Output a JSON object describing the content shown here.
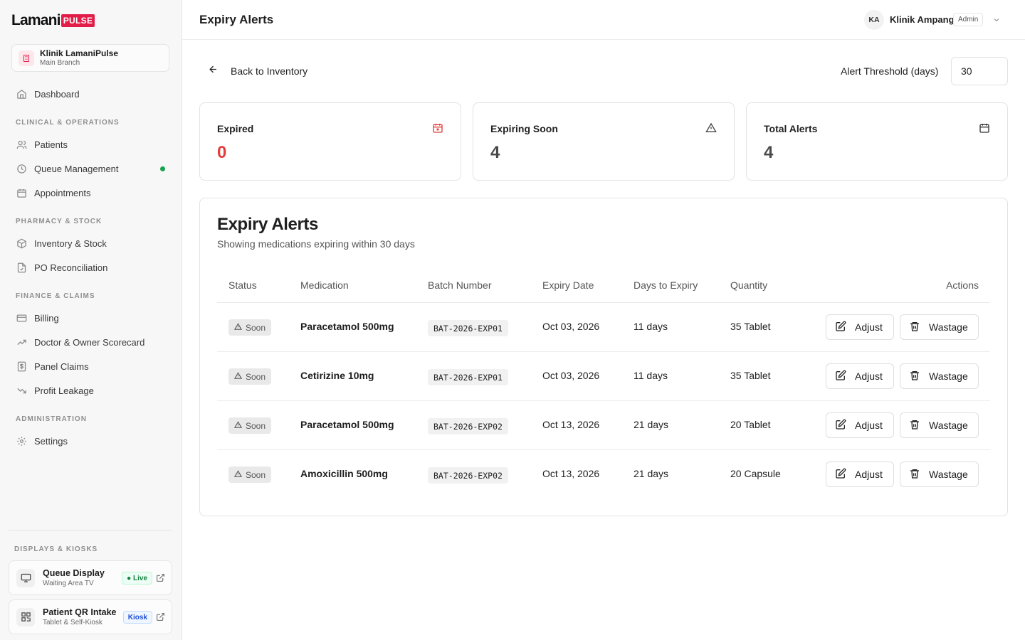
{
  "brand": {
    "name": "Lamani",
    "badge": "PULSE"
  },
  "clinic": {
    "name": "Klinik LamaniPulse",
    "branch": "Main Branch"
  },
  "nav": {
    "dashboard": "Dashboard",
    "sections": {
      "clinical": "CLINICAL & OPERATIONS",
      "pharmacy": "PHARMACY & STOCK",
      "finance": "FINANCE & CLAIMS",
      "admin": "ADMINISTRATION",
      "displays": "DISPLAYS & KIOSKS"
    },
    "items": {
      "patients": "Patients",
      "queue": "Queue Management",
      "appointments": "Appointments",
      "inventory": "Inventory & Stock",
      "po": "PO Reconciliation",
      "billing": "Billing",
      "scorecard": "Doctor & Owner Scorecard",
      "claims": "Panel Claims",
      "leakage": "Profit Leakage",
      "settings": "Settings"
    }
  },
  "kiosks": [
    {
      "title": "Queue Display",
      "subtitle": "Waiting Area TV",
      "badge": "● Live"
    },
    {
      "title": "Patient QR Intake",
      "subtitle": "Tablet & Self-Kiosk",
      "badge": "Kiosk"
    }
  ],
  "header": {
    "title": "Expiry Alerts",
    "user_initials": "KA",
    "user_name": "Klinik Ampang",
    "user_role": "Admin"
  },
  "toolbar": {
    "back_label": "Back to Inventory",
    "threshold_label": "Alert Threshold (days)",
    "threshold_value": "30"
  },
  "stats": [
    {
      "label": "Expired",
      "value": "0"
    },
    {
      "label": "Expiring Soon",
      "value": "4"
    },
    {
      "label": "Total Alerts",
      "value": "4"
    }
  ],
  "table": {
    "title": "Expiry Alerts",
    "subtitle": "Showing medications expiring within 30 days",
    "columns": [
      "Status",
      "Medication",
      "Batch Number",
      "Expiry Date",
      "Days to Expiry",
      "Quantity",
      "Actions"
    ],
    "rows": [
      {
        "status": "Soon",
        "medication": "Paracetamol 500mg",
        "batch": "BAT-2026-EXP01",
        "expiry": "Oct 03, 2026",
        "days": "11 days",
        "quantity": "35 Tablet"
      },
      {
        "status": "Soon",
        "medication": "Cetirizine 10mg",
        "batch": "BAT-2026-EXP01",
        "expiry": "Oct 03, 2026",
        "days": "11 days",
        "quantity": "35 Tablet"
      },
      {
        "status": "Soon",
        "medication": "Paracetamol 500mg",
        "batch": "BAT-2026-EXP02",
        "expiry": "Oct 13, 2026",
        "days": "21 days",
        "quantity": "20 Tablet"
      },
      {
        "status": "Soon",
        "medication": "Amoxicillin 500mg",
        "batch": "BAT-2026-EXP02",
        "expiry": "Oct 13, 2026",
        "days": "21 days",
        "quantity": "20 Capsule"
      }
    ],
    "adjust_label": "Adjust",
    "wastage_label": "Wastage"
  },
  "colors": {
    "brand": "#e11d48",
    "expired": "#e23d3d",
    "live": "#16a34a",
    "kiosk": "#1d4ed8"
  }
}
